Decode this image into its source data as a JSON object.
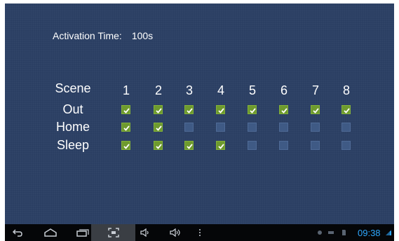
{
  "activation": {
    "label": "Activation Time:",
    "value": "100s"
  },
  "grid": {
    "header": "Scene",
    "columns": [
      "1",
      "2",
      "3",
      "4",
      "5",
      "6",
      "7",
      "8"
    ],
    "rows": [
      {
        "name": "Out",
        "checked": [
          true,
          true,
          true,
          true,
          true,
          true,
          true,
          true
        ]
      },
      {
        "name": "Home",
        "checked": [
          true,
          true,
          false,
          false,
          false,
          false,
          false,
          false
        ]
      },
      {
        "name": "Sleep",
        "checked": [
          true,
          true,
          true,
          true,
          false,
          false,
          false,
          false
        ]
      }
    ]
  },
  "statusbar": {
    "time": "09:38"
  },
  "icons": {
    "back": "back-icon",
    "home": "home-icon",
    "recents": "recent-apps-icon",
    "screenshot": "screenshot-icon",
    "vol_down": "volume-down-icon",
    "vol_up": "volume-up-icon",
    "menu": "menu-icon"
  },
  "colors": {
    "background": "#2b3f63",
    "checkbox_on": "#6e9a2e",
    "checkbox_off": "#3f5a85",
    "navbar": "#050608",
    "clock": "#2ea8ff"
  }
}
